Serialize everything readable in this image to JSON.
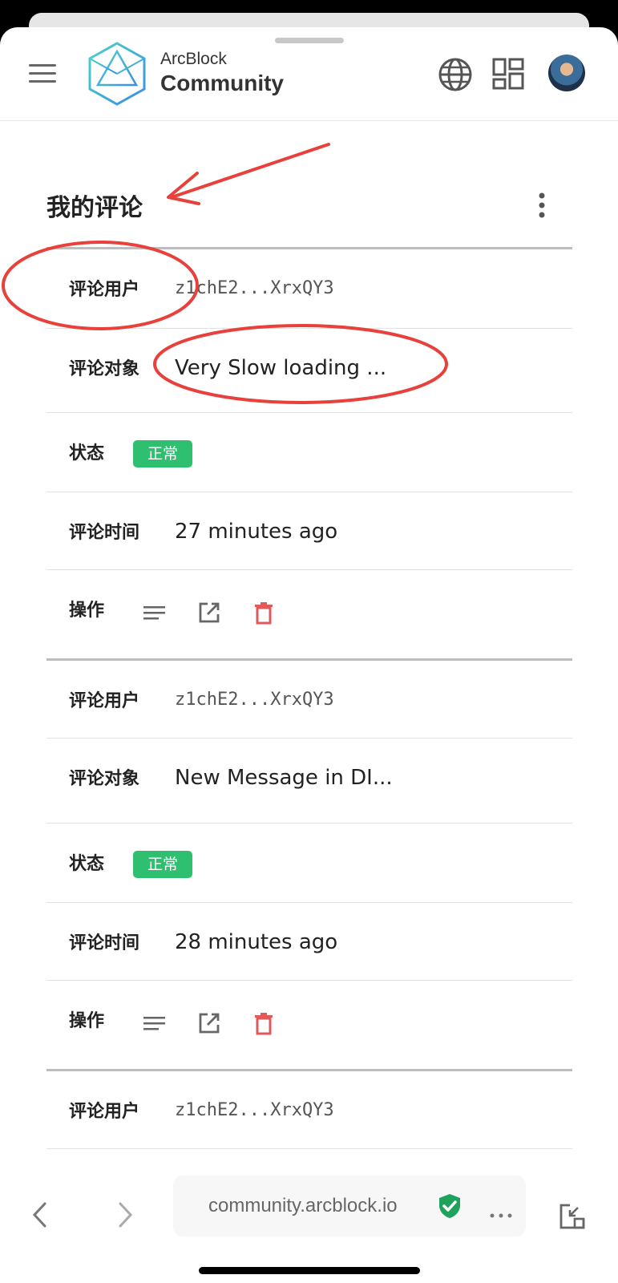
{
  "header": {
    "brand_top": "ArcBlock",
    "brand_main": "Community"
  },
  "page": {
    "title": "我的评论"
  },
  "records": [
    {
      "user_label": "评论用户",
      "user_value": "z1chE2...XrxQY3",
      "target_label": "评论对象",
      "target_value": "Very Slow loading ...",
      "status_label": "状态",
      "status_value": "正常",
      "time_label": "评论时间",
      "time_value": "27 minutes ago",
      "actions_label": "操作"
    },
    {
      "user_label": "评论用户",
      "user_value": "z1chE2...XrxQY3",
      "target_label": "评论对象",
      "target_value": "New Message in DI...",
      "status_label": "状态",
      "status_value": "正常",
      "time_label": "评论时间",
      "time_value": "28 minutes ago",
      "actions_label": "操作"
    },
    {
      "user_label": "评论用户",
      "user_value": "z1chE2...XrxQY3"
    }
  ],
  "browser": {
    "url": "community.arcblock.io"
  },
  "colors": {
    "status_green": "#2fbf71",
    "delete_red": "#e05a5a",
    "annotation_red": "#e8403a"
  },
  "icons": [
    "menu-icon",
    "arcblock-logo-icon",
    "globe-icon",
    "apps-grid-icon",
    "more-vert-icon",
    "list-detail-icon",
    "open-external-icon",
    "delete-icon",
    "back-icon",
    "forward-icon",
    "shield-check-icon",
    "more-horiz-icon",
    "picture-in-picture-icon"
  ]
}
